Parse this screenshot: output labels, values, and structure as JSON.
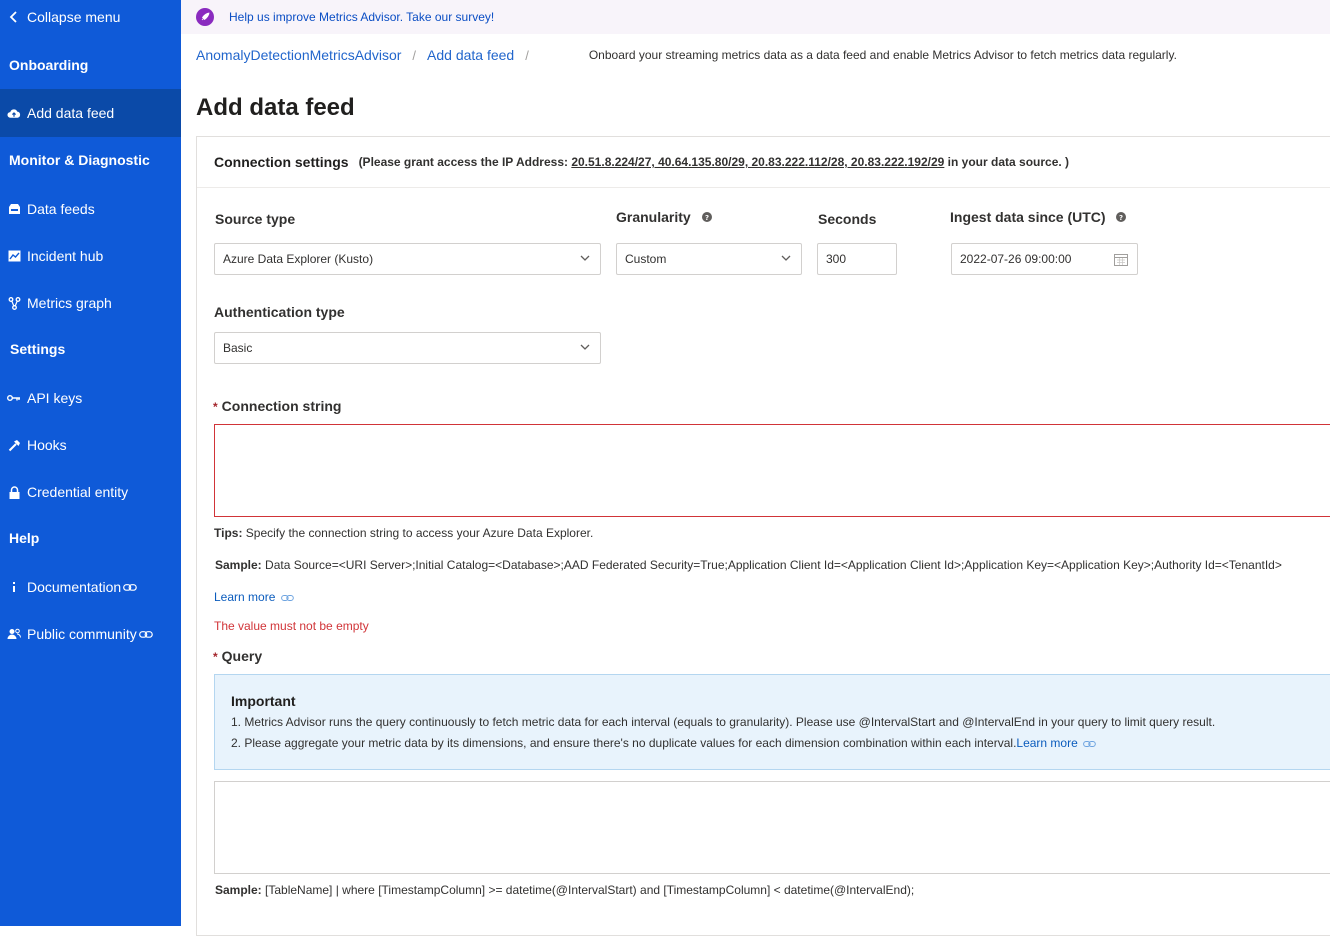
{
  "sidebar": {
    "collapse_label": "Collapse menu",
    "sections": {
      "onboarding": "Onboarding",
      "monitor": "Monitor & Diagnostic",
      "settings": "Settings",
      "help": "Help"
    },
    "items": {
      "add_data_feed": "Add data feed",
      "data_feeds": "Data feeds",
      "incident_hub": "Incident hub",
      "metrics_graph": "Metrics graph",
      "api_keys": "API keys",
      "hooks": "Hooks",
      "credential_entity": "Credential entity",
      "documentation": "Documentation",
      "public_community": "Public community"
    },
    "colors": {
      "background": "#0f5ad8",
      "active": "#0b4aa8"
    }
  },
  "survey": {
    "text": "Help us improve Metrics Advisor. Take our survey!"
  },
  "breadcrumb": {
    "items": [
      "AnomalyDetectionMetricsAdvisor",
      "Add data feed"
    ],
    "separator": "/",
    "description": "Onboard your streaming metrics data as a data feed and enable Metrics Advisor to fetch metrics data regularly."
  },
  "page_title": "Add data feed",
  "connection_settings": {
    "title": "Connection settings",
    "note_prefix": "(Please grant access the IP Address: ",
    "ip_addresses": "20.51.8.224/27, 40.64.135.80/29, 20.83.222.112/28, 20.83.222.192/29",
    "note_suffix": " in your data source. )"
  },
  "form": {
    "source_type": {
      "label": "Source type",
      "value": "Azure Data Explorer (Kusto)"
    },
    "granularity": {
      "label": "Granularity",
      "value": "Custom"
    },
    "seconds": {
      "label": "Seconds",
      "value": "300"
    },
    "ingest_since": {
      "label": "Ingest data since (UTC)",
      "value": "2022-07-26 09:00:00"
    },
    "auth_type": {
      "label": "Authentication type",
      "value": "Basic"
    },
    "connection_string": {
      "required_mark": "*",
      "label": "Connection string",
      "tips_label": "Tips:",
      "tips_text": " Specify the connection string to access your Azure Data Explorer.",
      "sample_label": "Sample:",
      "sample_text": " Data Source=<URI Server>;Initial Catalog=<Database>;AAD Federated Security=True;Application Client Id=<Application Client Id>;Application Key=<Application Key>;Authority Id=<TenantId>",
      "learn_more": "Learn more",
      "error": "The value must not be empty"
    },
    "query": {
      "required_mark": "*",
      "label": "Query",
      "important_title": "Important",
      "important_line1": "1. Metrics Advisor runs the query continuously to fetch metric data for each interval (equals to granularity). Please use @IntervalStart and @IntervalEnd in your query to limit query result.",
      "important_line2": "2. Please aggregate your metric data by its dimensions, and ensure there's no duplicate values for each dimension combination within each interval.",
      "learn_more": "Learn more",
      "sample_label": "Sample:",
      "sample_text": " [TableName] | where [TimestampColumn] >= datetime(@IntervalStart) and [TimestampColumn] < datetime(@IntervalEnd);"
    }
  }
}
